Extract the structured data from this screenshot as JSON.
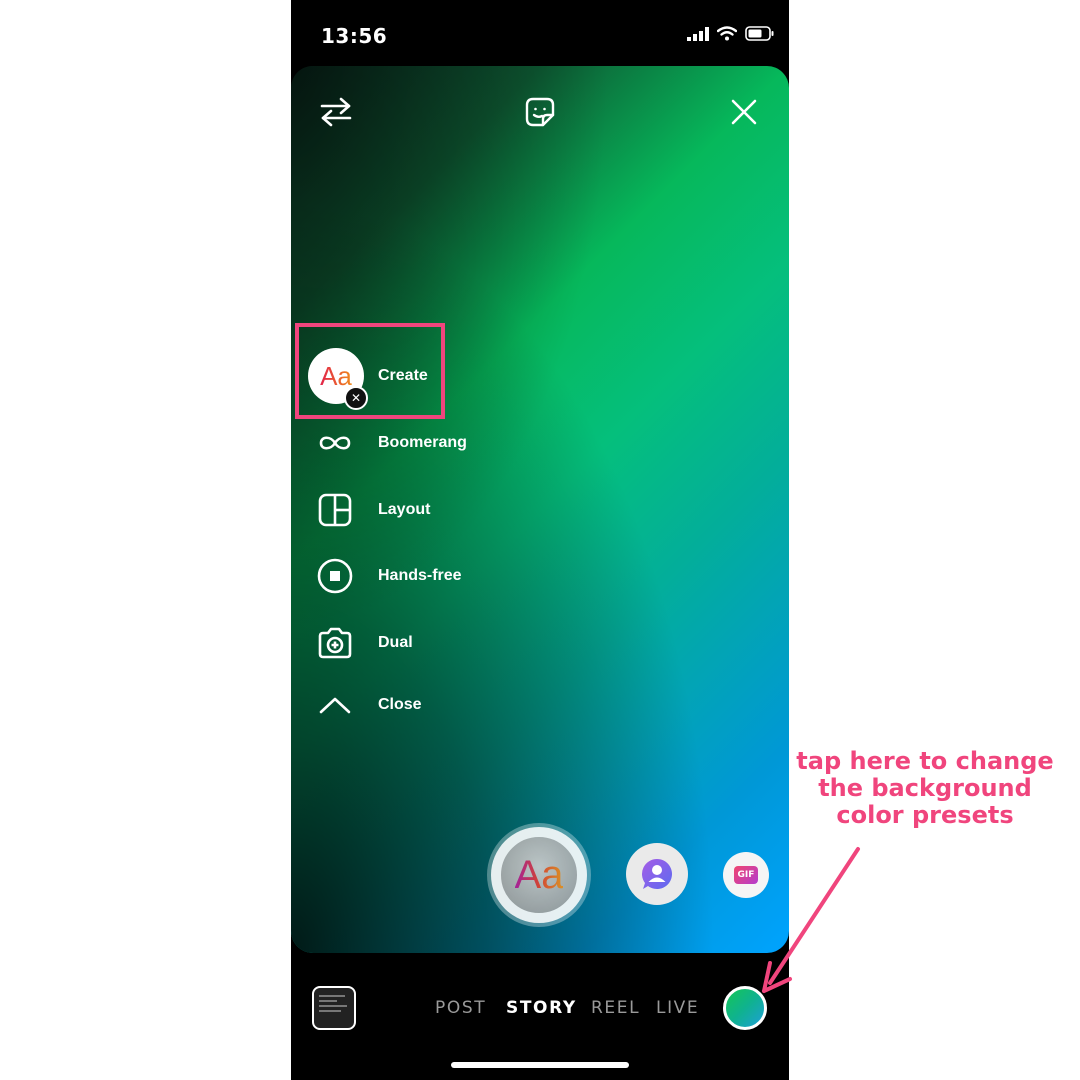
{
  "status_bar": {
    "time": "13:56"
  },
  "top_bar": {
    "icons": [
      "switch-camera-icon",
      "sticker-icon",
      "close-icon"
    ]
  },
  "create_menu": {
    "items": [
      {
        "label": "Create",
        "icon": "text-aa-icon"
      },
      {
        "label": "Boomerang",
        "icon": "infinity-icon"
      },
      {
        "label": "Layout",
        "icon": "layout-grid-icon"
      },
      {
        "label": "Hands-free",
        "icon": "stop-circle-icon"
      },
      {
        "label": "Dual",
        "icon": "dual-camera-icon"
      },
      {
        "label": "Close",
        "icon": "chevron-up-icon"
      }
    ]
  },
  "shutter": {
    "label": "Aa"
  },
  "side_buttons": {
    "gif_label": "GIF"
  },
  "modes": [
    "POST",
    "STORY",
    "REEL",
    "LIVE"
  ],
  "active_mode": "STORY",
  "annotation": {
    "line1": "tap here to change",
    "line2": "the background",
    "line3": "color presets"
  },
  "colors": {
    "highlight": "#f0457d",
    "gradient_start": "#06b85b",
    "gradient_end": "#00a3ff"
  }
}
